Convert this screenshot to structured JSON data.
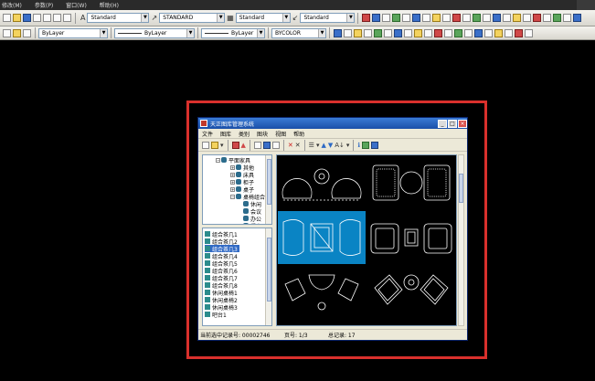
{
  "menubar": {
    "items": [
      "修改(M)",
      "参数(P)",
      "窗口(W)",
      "帮助(H)"
    ]
  },
  "toolbar1": {
    "text_style": "Standard",
    "dim_style": "STANDARD",
    "table_style": "Standard",
    "multileader_style": "Standard"
  },
  "toolbar2": {
    "color": "ByLayer",
    "linetype": "ByLayer",
    "lineweight": "ByLayer",
    "plotstyle": "BYCOLOR"
  },
  "dialog": {
    "title": "天正图库管理系统",
    "menu": [
      "文件",
      "图库",
      "类别",
      "图块",
      "视图",
      "帮助"
    ],
    "tree": [
      {
        "label": "平面家具",
        "level": 0,
        "expanded": true
      },
      {
        "label": "其他",
        "level": 1
      },
      {
        "label": "床具",
        "level": 1
      },
      {
        "label": "柜子",
        "level": 1
      },
      {
        "label": "桌子",
        "level": 1
      },
      {
        "label": "桌椅组合",
        "level": 1,
        "expanded": true
      },
      {
        "label": "休闲",
        "level": 2
      },
      {
        "label": "会议",
        "level": 2
      },
      {
        "label": "办公",
        "level": 2
      },
      {
        "label": "餐桌",
        "level": 2
      }
    ],
    "list": [
      {
        "label": "组合茶几1"
      },
      {
        "label": "组合茶几2"
      },
      {
        "label": "组合茶几3",
        "selected": true
      },
      {
        "label": "组合茶几4"
      },
      {
        "label": "组合茶几5"
      },
      {
        "label": "组合茶几6"
      },
      {
        "label": "组合茶几7"
      },
      {
        "label": "组合茶几8"
      },
      {
        "label": "休闲桌椅1"
      },
      {
        "label": "休闲桌椅2"
      },
      {
        "label": "休闲桌椅3"
      },
      {
        "label": "吧台1"
      }
    ],
    "status": {
      "record": "当前选中记录号:  00002746",
      "page": "页号:  1/3",
      "total": "总记录:   17"
    }
  },
  "colors": {
    "highlight": "#d9302c",
    "selection": "#0a84c4",
    "list_selection": "#316ac5",
    "titlebar": "#1a4fa8"
  }
}
